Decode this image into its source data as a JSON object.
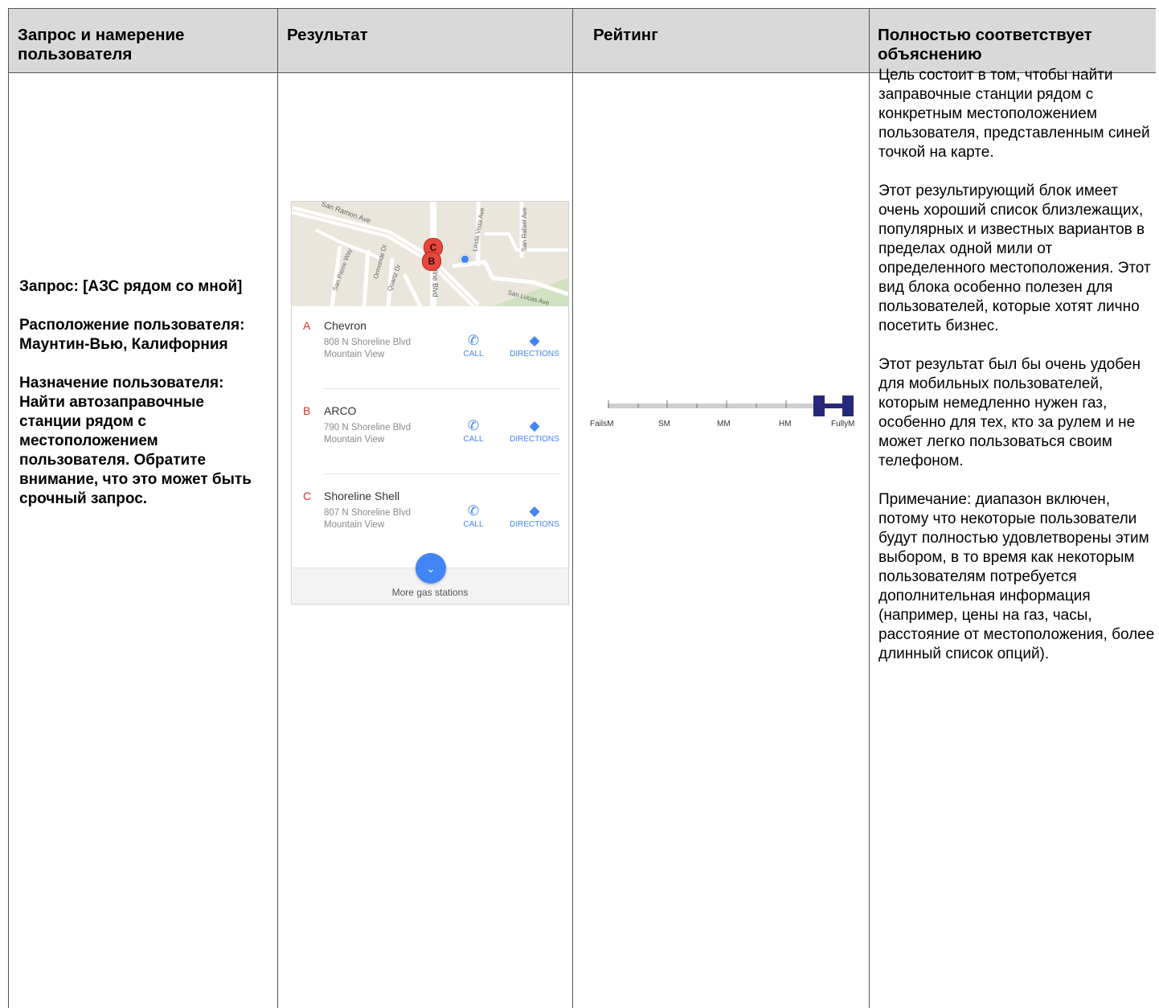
{
  "headers": {
    "query": "Запрос и намерение пользователя",
    "result": "Результат",
    "rating": "Рейтинг",
    "explanation": "Полностью соответствует объяснению"
  },
  "query_cell": {
    "query": "Запрос: [АЗС рядом со мной]",
    "location": "Расположение пользователя: Маунтин-Вью, Калифорния",
    "intent": "Назначение пользователя: Найти автозаправочные станции рядом с местоположением пользователя. Обратите внимание, что это может быть срочный запрос."
  },
  "result_card": {
    "map": {
      "streets": [
        "San Ramon Ave",
        "San Pierre Way",
        "Ormonde Dr",
        "Quartz Dr",
        "N Shoreline Blvd",
        "Linda Vista Ave",
        "San Rafael Ave",
        "San Lucas Ave"
      ],
      "markers": [
        "C",
        "B"
      ]
    },
    "listings": [
      {
        "letter": "A",
        "name": "Chevron",
        "address1": "808 N Shoreline Blvd",
        "address2": "Mountain View",
        "call": "CALL",
        "directions": "DIRECTIONS"
      },
      {
        "letter": "B",
        "name": "ARCO",
        "address1": "790 N Shoreline Blvd",
        "address2": "Mountain View",
        "call": "CALL",
        "directions": "DIRECTIONS"
      },
      {
        "letter": "C",
        "name": "Shoreline Shell",
        "address1": "807 N Shoreline Blvd",
        "address2": "Mountain View",
        "call": "CALL",
        "directions": "DIRECTIONS"
      }
    ],
    "more_label": "More gas stations"
  },
  "rating": {
    "labels": [
      "FailsM",
      "SM",
      "MM",
      "HM",
      "FullyM"
    ],
    "selected_range": [
      "HM",
      "FullyM"
    ]
  },
  "explanation_paragraphs": [
    "Цель состоит в том, чтобы найти заправочные станции рядом с конкретным местоположением пользователя, представленным синей точкой на карте.",
    "Этот результирующий блок имеет очень хороший список близлежащих, популярных и известных вариантов в пределах одной мили от определенного местоположения. Этот вид блока особенно полезен для пользователей, которые хотят лично посетить бизнес.",
    "Этот результат был бы очень удобен для мобильных пользователей, которым немедленно нужен газ, особенно для тех, кто за рулем и не может легко пользоваться своим телефоном.",
    "Примечание: диапазон включен, потому что некоторые пользователи будут полностью удовлетворены этим выбором, в то время как некоторым пользователям потребуется дополнительная информация (например, цены на газ, часы, расстояние от местоположения, более длинный список опций)."
  ],
  "colors": {
    "header_bg": "#d9d9d9",
    "border": "#555555",
    "accent_blue": "#4285f4",
    "marker_red": "#d93025",
    "rating_navy": "#26297a"
  }
}
